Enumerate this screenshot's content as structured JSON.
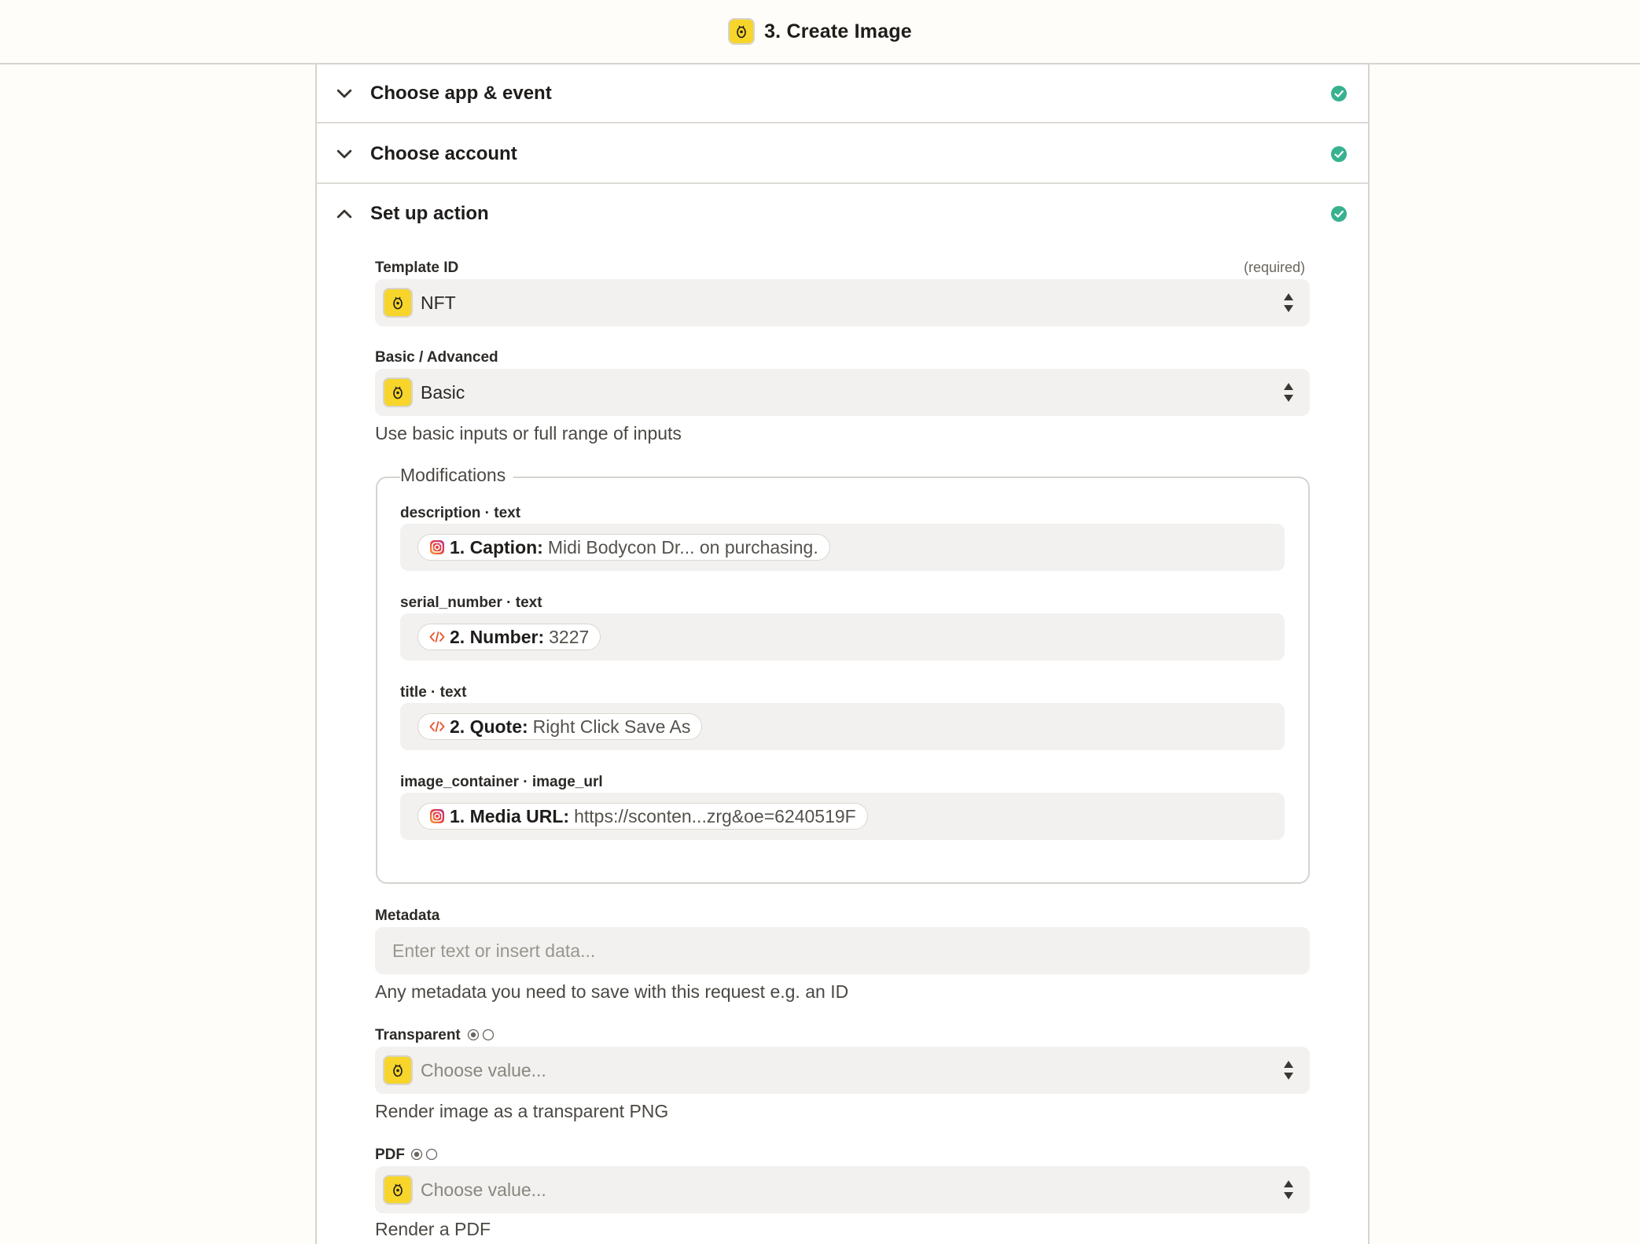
{
  "header": {
    "title": "3. Create Image"
  },
  "sections": [
    {
      "label": "Choose app & event",
      "expanded": false,
      "complete": true
    },
    {
      "label": "Choose account",
      "expanded": false,
      "complete": true
    },
    {
      "label": "Set up action",
      "expanded": true,
      "complete": true
    }
  ],
  "form": {
    "template_id": {
      "label": "Template ID",
      "required_text": "(required)",
      "value": "NFT"
    },
    "basic_advanced": {
      "label": "Basic / Advanced",
      "value": "Basic",
      "help": "Use basic inputs or full range of inputs"
    },
    "modifications": {
      "legend": "Modifications",
      "fields": [
        {
          "label": "description · text",
          "pill_key": "1. Caption:",
          "pill_value": "Midi Bodycon Dr... on purchasing.",
          "icon": "instagram-icon"
        },
        {
          "label": "serial_number · text",
          "pill_key": "2. Number:",
          "pill_value": "3227",
          "icon": "code-icon"
        },
        {
          "label": "title · text",
          "pill_key": "2. Quote:",
          "pill_value": "Right Click Save As",
          "icon": "code-icon"
        },
        {
          "label": "image_container · image_url",
          "pill_key": "1. Media URL:",
          "pill_value": "https://sconten...zrg&oe=6240519F",
          "icon": "instagram-icon"
        }
      ]
    },
    "metadata": {
      "label": "Metadata",
      "placeholder": "Enter text or insert data...",
      "help": "Any metadata you need to save with this request e.g. an ID"
    },
    "transparent": {
      "label": "Transparent",
      "placeholder": "Choose value...",
      "help": "Render image as a transparent PNG"
    },
    "pdf": {
      "label": "PDF",
      "placeholder": "Choose value...",
      "help": "Render a PDF"
    }
  },
  "colors": {
    "accent_check": "#37b18f",
    "app_icon_bg": "#f7d52a",
    "field_bg": "#f2f1ef",
    "page_bg": "#fffdf9"
  }
}
